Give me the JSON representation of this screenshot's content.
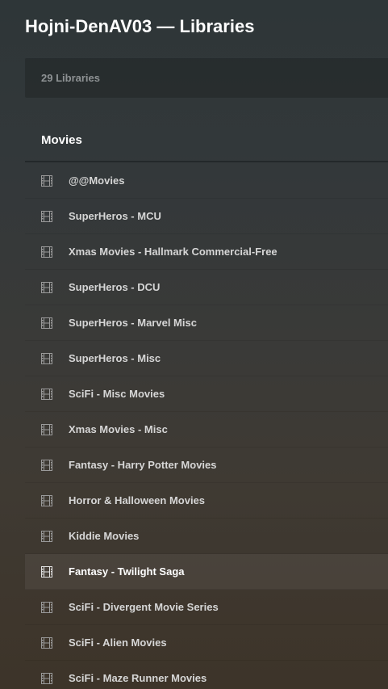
{
  "header": {
    "title": "Hojni-DenAV03 — Libraries"
  },
  "summary": {
    "count_text": "29 Libraries"
  },
  "section": {
    "title": "Movies"
  },
  "libraries": [
    {
      "label": "@@Movies",
      "icon": "film-icon",
      "active": false
    },
    {
      "label": "SuperHeros - MCU",
      "icon": "film-icon",
      "active": false
    },
    {
      "label": "Xmas Movies - Hallmark Commercial-Free",
      "icon": "film-icon",
      "active": false
    },
    {
      "label": "SuperHeros - DCU",
      "icon": "film-icon",
      "active": false
    },
    {
      "label": "SuperHeros - Marvel Misc",
      "icon": "film-icon",
      "active": false
    },
    {
      "label": "SuperHeros - Misc",
      "icon": "film-icon",
      "active": false
    },
    {
      "label": "SciFi - Misc Movies",
      "icon": "film-icon",
      "active": false
    },
    {
      "label": "Xmas Movies - Misc",
      "icon": "film-icon",
      "active": false
    },
    {
      "label": "Fantasy - Harry Potter Movies",
      "icon": "film-icon",
      "active": false
    },
    {
      "label": "Horror & Halloween Movies",
      "icon": "film-icon",
      "active": false
    },
    {
      "label": "Kiddie Movies",
      "icon": "film-icon",
      "active": false
    },
    {
      "label": "Fantasy - Twilight Saga",
      "icon": "film-icon",
      "active": true
    },
    {
      "label": "SciFi - Divergent Movie Series",
      "icon": "film-icon",
      "active": false
    },
    {
      "label": "SciFi - Alien Movies",
      "icon": "film-icon",
      "active": false
    },
    {
      "label": "SciFi - Maze Runner Movies",
      "icon": "film-icon",
      "active": false
    }
  ],
  "colors": {
    "title": "#ffffff",
    "item_text": "#d6d6d6",
    "muted_text": "#8e9294",
    "icon": "#9a9a9a"
  }
}
